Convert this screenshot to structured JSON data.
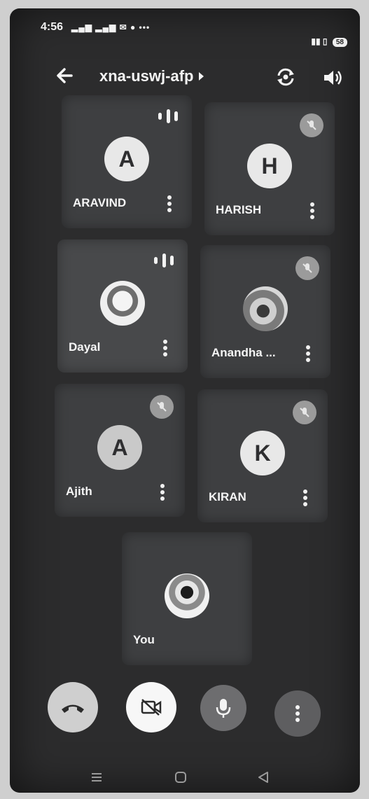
{
  "status": {
    "time": "4:56",
    "battery": "58"
  },
  "header": {
    "title": "xna-uswj-afp"
  },
  "participants": [
    {
      "name": "ARAVIND",
      "initial": "A",
      "audio": "speaking"
    },
    {
      "name": "HARISH",
      "initial": "H",
      "audio": "muted"
    },
    {
      "name": "Dayal",
      "initial": "",
      "audio": "speaking"
    },
    {
      "name": "Anandha ...",
      "initial": "",
      "audio": "muted"
    },
    {
      "name": "Ajith",
      "initial": "A",
      "audio": "muted"
    },
    {
      "name": "KIRAN",
      "initial": "K",
      "audio": "muted"
    }
  ],
  "self": {
    "name": "You"
  },
  "controls": {
    "end_call": "phone-hangup-icon",
    "camera": "camera-off-icon",
    "mic": "microphone-icon",
    "more": "more-vertical-icon"
  },
  "colors": {
    "background": "#2c2c2d",
    "tile": "#3e3f41",
    "end_call": "#cfcfcf",
    "camera_button": "#f7f7f7",
    "mic_button": "#6d6d6f",
    "more_button": "#5e5e60"
  }
}
